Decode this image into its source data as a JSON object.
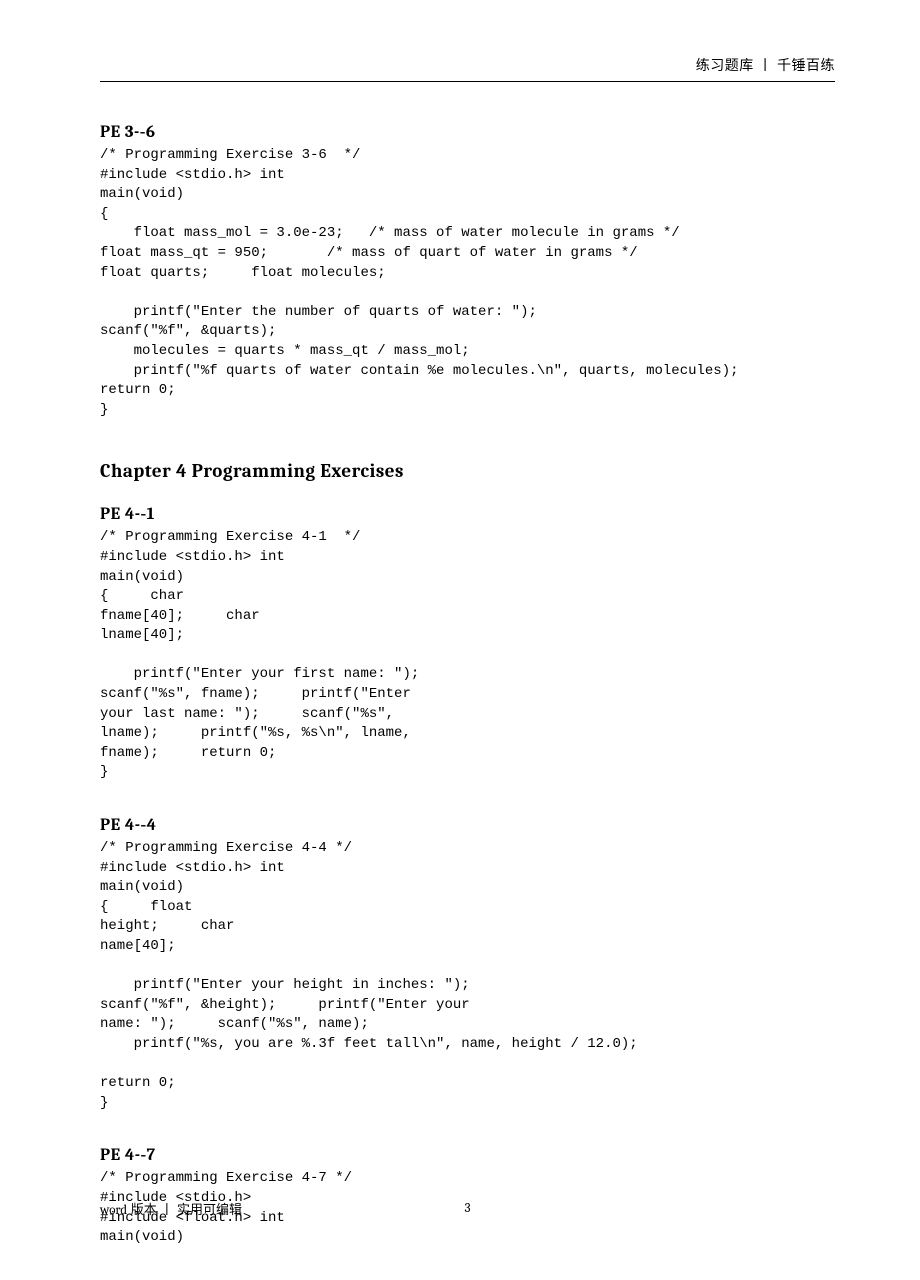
{
  "header": {
    "text": "练习题库 丨 千锤百练"
  },
  "sections": {
    "pe36": {
      "title": "PE   3-‐6",
      "code": "/* Programming Exercise 3-6  */\n#include <stdio.h> int\nmain(void)\n{\n    float mass_mol = 3.0e-23;   /* mass of water molecule in grams */\nfloat mass_qt = 950;       /* mass of quart of water in grams */\nfloat quarts;     float molecules;\n\n    printf(\"Enter the number of quarts of water: \");\nscanf(\"%f\", &quarts);\n    molecules = quarts * mass_qt / mass_mol;\n    printf(\"%f quarts of water contain %e molecules.\\n\", quarts, molecules);\nreturn 0;\n}"
    },
    "chapter4": {
      "title": "Chapter  4   Programming   Exercises"
    },
    "pe41": {
      "title": "PE   4-‐1",
      "code": "/* Programming Exercise 4-1  */\n#include <stdio.h> int\nmain(void)\n{     char\nfname[40];     char\nlname[40];\n\n    printf(\"Enter your first name: \");\nscanf(\"%s\", fname);     printf(\"Enter\nyour last name: \");     scanf(\"%s\",\nlname);     printf(\"%s, %s\\n\", lname,\nfname);     return 0;\n}"
    },
    "pe44": {
      "title": "PE   4-‐4",
      "code": "/* Programming Exercise 4-4 */\n#include <stdio.h> int\nmain(void)\n{     float\nheight;     char\nname[40];\n\n    printf(\"Enter your height in inches: \");\nscanf(\"%f\", &height);     printf(\"Enter your\nname: \");     scanf(\"%s\", name);\n    printf(\"%s, you are %.3f feet tall\\n\", name, height / 12.0);\n\nreturn 0;\n}"
    },
    "pe47": {
      "title": "PE   4-‐7",
      "code": "/* Programming Exercise 4-7 */\n#include <stdio.h>\n#include <float.h> int\nmain(void)"
    }
  },
  "footer": {
    "left_word": "word",
    "left_text": " 版本 丨 实用可编辑",
    "page_number": "3"
  }
}
